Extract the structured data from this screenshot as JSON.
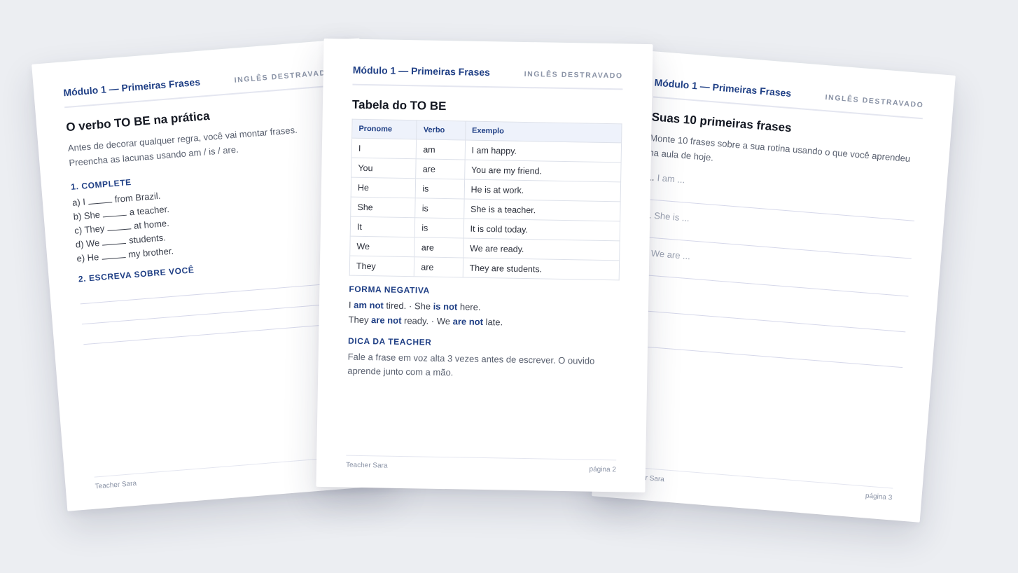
{
  "header": {
    "title": "Módulo 1 — Primeiras Frases",
    "brand": "INGLÊS DESTRAVADO"
  },
  "page1": {
    "title": "O verbo TO BE na prática",
    "intro1": "Antes de decorar qualquer regra, você vai montar frases.",
    "intro2": "Preencha as lacunas usando am / is / are.",
    "section1": "1. COMPLETE",
    "exercises": [
      {
        "prefix": "a) I",
        "suffix": "from Brazil."
      },
      {
        "prefix": "b) She",
        "suffix": "a teacher."
      },
      {
        "prefix": "c) They",
        "suffix": "at home."
      },
      {
        "prefix": "d) We",
        "suffix": "students."
      },
      {
        "prefix": "e) He",
        "suffix": "my brother."
      }
    ],
    "section2": "2. ESCREVA SOBRE VOCÊ",
    "footer_author": "Teacher Sara"
  },
  "page2": {
    "title": "Tabela do TO BE",
    "columns": [
      "Pronome",
      "Verbo",
      "Exemplo"
    ],
    "rows": [
      [
        "I",
        "am",
        "I am happy."
      ],
      [
        "You",
        "are",
        "You are my friend."
      ],
      [
        "He",
        "is",
        "He is at work."
      ],
      [
        "She",
        "is",
        "She is a teacher."
      ],
      [
        "It",
        "is",
        "It is cold today."
      ],
      [
        "We",
        "are",
        "We are ready."
      ],
      [
        "They",
        "are",
        "They are students."
      ]
    ],
    "neg_heading": "FORMA NEGATIVA",
    "neg": {
      "l1a": "I ",
      "l1b": "am not",
      "l1c": " tired.  ·  She ",
      "l1d": "is not",
      "l1e": " here.",
      "l2a": "They ",
      "l2b": "are not",
      "l2c": " ready.  ·  We ",
      "l2d": "are not",
      "l2e": " late."
    },
    "tip_heading": "DICA DA TEACHER",
    "tip": "Fale a frase em voz alta 3 vezes antes de escrever. O ouvido aprende junto com a mão.",
    "footer_author": "Teacher Sara",
    "footer_page": "página 2"
  },
  "page3": {
    "title": "Suas 10 primeiras frases",
    "intro": "Monte 10 frases sobre a sua rotina usando o que você aprendeu na aula de hoje.",
    "tasks": [
      {
        "n": "1.",
        "hint": "I am ..."
      },
      {
        "n": "2.",
        "hint": "She is ..."
      },
      {
        "n": "3.",
        "hint": "We are ..."
      }
    ],
    "footer_author": "Teacher Sara",
    "footer_page": "página 3"
  }
}
